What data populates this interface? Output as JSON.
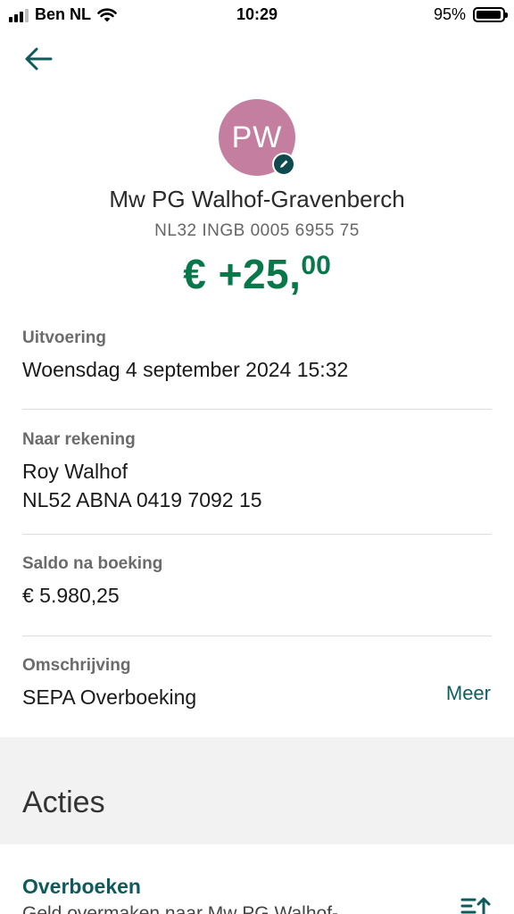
{
  "status_bar": {
    "carrier": "Ben NL",
    "time": "10:29",
    "battery_percent": "95%",
    "battery_level": 0.95
  },
  "nav": {
    "back_icon": "arrow-left-icon"
  },
  "counterparty": {
    "initials": "PW",
    "avatar_color": "#c47fa0",
    "name": "Mw PG Walhof-Gravenberch",
    "iban": "NL32 INGB 0005 6955 75"
  },
  "amount": {
    "main": "€ +25,",
    "cents": "00",
    "color": "#08784b"
  },
  "details": {
    "execution": {
      "label": "Uitvoering",
      "value": "Woensdag 4 september 2024 15:32"
    },
    "to_account": {
      "label": "Naar rekening",
      "name": "Roy Walhof",
      "iban": "NL52 ABNA 0419 7092 15"
    },
    "balance_after": {
      "label": "Saldo na boeking",
      "value": "€ 5.980,25"
    },
    "description": {
      "label": "Omschrijving",
      "value": "SEPA Overboeking",
      "more_label": "Meer"
    }
  },
  "actions": {
    "title": "Acties",
    "items": [
      {
        "title": "Overboeken",
        "description": "Geld overmaken naar Mw PG Walhof-",
        "icon": "transfer-icon"
      }
    ]
  }
}
